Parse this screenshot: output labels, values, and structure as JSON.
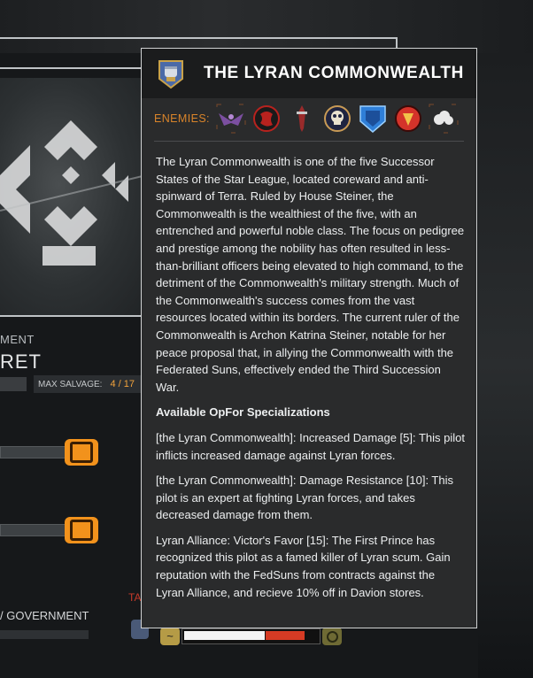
{
  "background": {
    "section_label": "MENT",
    "section_value": "RET",
    "max_salvage_label": "MAX SALVAGE:",
    "max_salvage_value": "4 / 17",
    "government_label": "/ GOVERNMENT",
    "red_text": "TA"
  },
  "tooltip": {
    "title": "THE LYRAN COMMONWEALTH",
    "logo_icon": "lyran-fist-icon",
    "enemies_label": "ENEMIES:",
    "enemies": [
      {
        "icon": "eagle-faction-icon",
        "color": "#7b4fa0"
      },
      {
        "icon": "red-dragon-faction-icon",
        "color": "#b8221e"
      },
      {
        "icon": "sword-faction-icon",
        "color": "#9a2b2b"
      },
      {
        "icon": "skull-faction-icon",
        "color": "#c89a55"
      },
      {
        "icon": "blue-shield-faction-icon",
        "color": "#2f7fd8"
      },
      {
        "icon": "red-sun-faction-icon",
        "color": "#d4332a"
      },
      {
        "icon": "white-cloud-faction-icon",
        "color": "#e8e8e8"
      }
    ],
    "description": "The Lyran Commonwealth is one of the five Successor States of the Star League, located coreward and anti-spinward of Terra. Ruled by House Steiner, the Commonwealth is the wealthiest of the five, with an entrenched and powerful noble class. The focus on pedigree and prestige among the nobility has often resulted in less-than-brilliant officers being elevated to high command, to the detriment of the Commonwealth's military strength. Much of the Commonwealth's success comes from the vast resources located within its borders. The current ruler of the Commonwealth is Archon Katrina Steiner, notable for her peace proposal that, in allying the Commonwealth with the Federated Suns, effectively ended the Third Succession War.",
    "specializations_heading": "Available OpFor Specializations",
    "specializations": [
      "[the Lyran Commonwealth]: Increased Damage [5]: This pilot inflicts increased damage against Lyran forces.",
      "[the Lyran Commonwealth]: Damage Resistance [10]: This pilot is an expert at fighting Lyran forces, and takes decreased damage from them.",
      "Lyran Alliance: Victor's Favor [15]: The First Prince has recognized this pilot as a famed killer of Lyran scum. Gain reputation with the FedSuns from contracts against the Lyran Alliance, and recieve 10% off in Davion stores."
    ]
  },
  "reputation": {
    "left_icon": "wave-icon",
    "right_icon": "ring-icon",
    "white_fill": 0.6,
    "red_fill": 0.29
  },
  "colors": {
    "accent_orange": "#d9842a",
    "tooltip_bg": "#2a2b2c",
    "header_bg": "#1b1c1d"
  }
}
